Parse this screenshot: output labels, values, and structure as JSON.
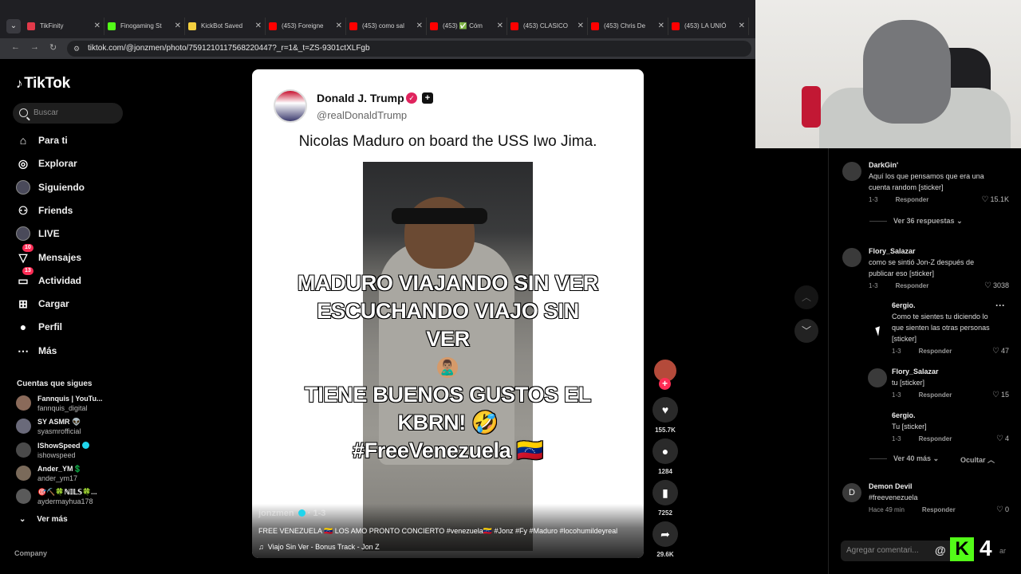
{
  "browser": {
    "tabs": [
      {
        "label": "TikFinity",
        "color": "#e23a4a"
      },
      {
        "label": "Finogaming St",
        "color": "#53fc18"
      },
      {
        "label": "KickBot Saved",
        "color": "#f4d03f"
      },
      {
        "label": "(453) Foreigne",
        "color": "#ff0000"
      },
      {
        "label": "(453) como sal",
        "color": "#ff0000"
      },
      {
        "label": "(453) ✅ Cóm",
        "color": "#ff0000"
      },
      {
        "label": "(453) CLASICO",
        "color": "#ff0000"
      },
      {
        "label": "(453) Chris De",
        "color": "#ff0000"
      },
      {
        "label": "(453) LA UNIÓ",
        "color": "#ff0000"
      }
    ],
    "url": "tiktok.com/@jonzmen/photo/7591210117568220447?_r=1&_t=ZS-9301ctXLFgb"
  },
  "sidebar": {
    "logo": "TikTok",
    "search_placeholder": "Buscar",
    "nav": [
      {
        "label": "Para ti",
        "icon": "home-icon"
      },
      {
        "label": "Explorar",
        "icon": "compass-icon"
      },
      {
        "label": "Siguiendo",
        "icon": "following-avatar-icon"
      },
      {
        "label": "Friends",
        "icon": "friends-icon"
      },
      {
        "label": "LIVE",
        "icon": "live-icon"
      },
      {
        "label": "Mensajes",
        "icon": "messages-icon",
        "badge": "10"
      },
      {
        "label": "Actividad",
        "icon": "activity-icon",
        "badge": "13"
      },
      {
        "label": "Cargar",
        "icon": "upload-icon"
      },
      {
        "label": "Perfil",
        "icon": "profile-icon"
      },
      {
        "label": "Más",
        "icon": "more-icon"
      }
    ],
    "following_title": "Cuentas que sigues",
    "following": [
      {
        "name": "Fannquis | YouTu...",
        "handle": "fannquis_digital",
        "color": "#8a6a5a"
      },
      {
        "name": "SY ASMR 👽",
        "handle": "syasmrofficial",
        "color": "#6a6a7a"
      },
      {
        "name": "IShowSpeed",
        "handle": "ishowspeed",
        "color": "#4a4a4a",
        "verified": true
      },
      {
        "name": "Ander_YM💲",
        "handle": "ander_ym17",
        "color": "#7a6a5a"
      },
      {
        "name": "🎯⛏️🍀ℕ𝕀𝕃𝕊🍀...",
        "handle": "aydermayhua178",
        "color": "#5a5a5a"
      }
    ],
    "see_more": "Ver más",
    "company": "Company"
  },
  "post": {
    "tweet_name": "Donald J. Trump",
    "tweet_handle": "@realDonaldTrump",
    "tweet_text": "Nicolas Maduro on board the USS Iwo Jima.",
    "overlay_lines": [
      "MADURO VIAJANDO SIN VER",
      "ESCUCHANDO VIAJO SIN",
      "VER",
      "TIENE BUENOS GUSTOS EL",
      "KBRN! 🤣",
      "#FreeVenezuela 🇻🇪"
    ],
    "emoji_mid": "🙎🏽‍♂️",
    "author": "jonzmen",
    "date": "1-3",
    "caption": "FREE VENEZUELA 🇻🇪 LOS AMO PRONTO CONCIERTO #venezuela🇻🇪 #Jonz #Fy #Maduro #locohumildeyreal",
    "music": "Viajo Sin Ver - Bonus Track - Jon Z"
  },
  "actions": {
    "likes": "155.7K",
    "comments": "1284",
    "saves": "7252",
    "shares": "29.6K"
  },
  "comments": {
    "reply_label": "Responder",
    "items": [
      {
        "user": "DarkGin'",
        "text": "Aquí los que pensamos que era una cuenta random [sticker]",
        "date": "1-3",
        "likes": "15.1K"
      },
      {
        "user": "Flory_Salazar",
        "text": "como se sintió Jon-Z después de publicar eso [sticker]",
        "date": "1-3",
        "likes": "3038"
      },
      {
        "user": "6ergio.",
        "text": "Como te sientes tu diciendo lo que sienten las otras personas [sticker]",
        "date": "1-3",
        "likes": "47"
      },
      {
        "user": "Flory_Salazar",
        "text": "tu [sticker]",
        "date": "1-3",
        "likes": "15"
      },
      {
        "user": "6ergio.",
        "text": "Tu [sticker]",
        "date": "1-3",
        "likes": "4"
      },
      {
        "user": "Demon Devil",
        "text": "#freevenezuela",
        "date": "Hace 49 min",
        "likes": "0",
        "avatar_letter": "D"
      }
    ],
    "more_replies_1": "Ver 36 respuestas",
    "more_replies_2": "Ver 40 más",
    "hide": "Ocultar",
    "add_placeholder": "Agregar comentari...",
    "at": "@",
    "post_label": "ar"
  },
  "overlay": {
    "kick_logo": "K",
    "kick_count": "4"
  }
}
